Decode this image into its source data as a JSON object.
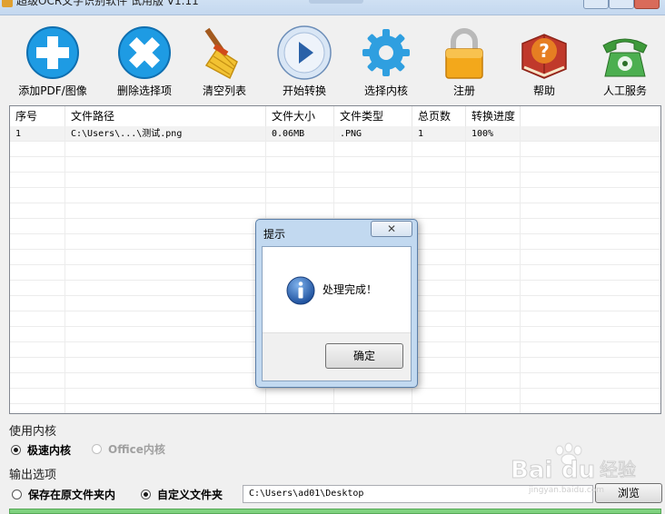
{
  "window": {
    "title": "超级OCR文字识别软件 试用版 V1.11"
  },
  "toolbar": [
    {
      "label": "添加PDF/图像",
      "icon": "add-icon"
    },
    {
      "label": "删除选择项",
      "icon": "delete-icon"
    },
    {
      "label": "清空列表",
      "icon": "broom-icon"
    },
    {
      "label": "开始转换",
      "icon": "play-icon"
    },
    {
      "label": "选择内核",
      "icon": "gear-icon"
    },
    {
      "label": "注册",
      "icon": "lock-icon"
    },
    {
      "label": "帮助",
      "icon": "help-book-icon"
    },
    {
      "label": "人工服务",
      "icon": "phone-icon"
    }
  ],
  "table": {
    "columns": [
      "序号",
      "文件路径",
      "文件大小",
      "文件类型",
      "总页数",
      "转换进度"
    ],
    "rows": [
      [
        "1",
        "C:\\Users\\...\\测试.png",
        "0.06MB",
        ".PNG",
        "1",
        "100%"
      ]
    ]
  },
  "engine": {
    "title": "使用内核",
    "options": [
      {
        "label": "极速内核",
        "selected": true,
        "enabled": true
      },
      {
        "label": "Office内核",
        "selected": false,
        "enabled": false
      }
    ]
  },
  "output": {
    "title": "输出选项",
    "options": [
      {
        "label": "保存在原文件夹内",
        "selected": false
      },
      {
        "label": "自定义文件夹",
        "selected": true
      }
    ],
    "path": "C:\\Users\\ad01\\Desktop",
    "browse_label": "浏览"
  },
  "dialog": {
    "title": "提示",
    "message": "处理完成！",
    "ok_label": "确定",
    "close_symbol": "✕"
  },
  "watermark": {
    "brand": "Bai du 经验",
    "url": "jingyan.baidu.com"
  },
  "colors": {
    "blue_icon": "#1e9be3",
    "accent_status": "#7fd27f",
    "dialog_frame": "#c2d9f0"
  }
}
